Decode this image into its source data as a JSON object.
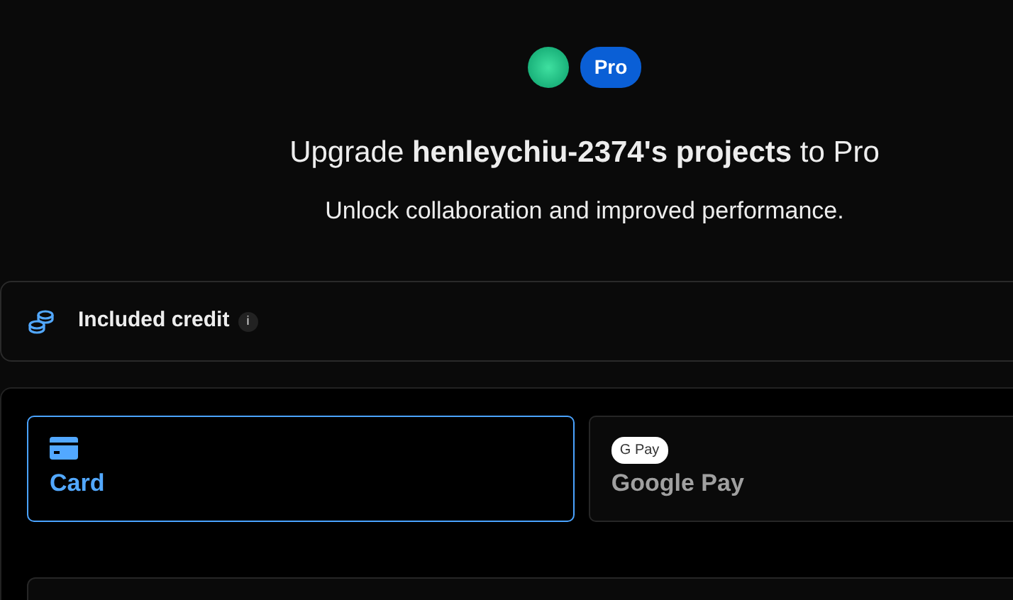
{
  "header": {
    "badge": "Pro",
    "title": "Upgrade **henleychiu-2374's projects** to Pro",
    "subtitle": "Unlock collaboration and improved performance."
  },
  "credit": {
    "label": "Included credit",
    "info": "i"
  },
  "payment_methods": [
    {
      "kind": "card",
      "label": "Card",
      "selected": true
    },
    {
      "kind": "googlepay",
      "label": "Google Pay",
      "mark": "G Pay",
      "selected": false
    }
  ]
}
